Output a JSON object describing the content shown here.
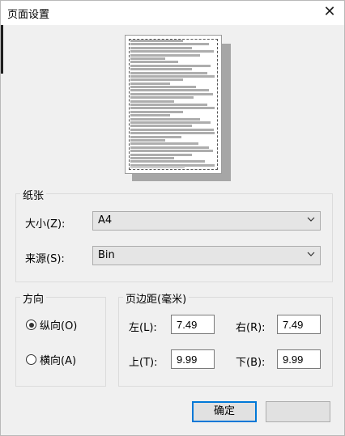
{
  "window": {
    "title": "页面设置",
    "close_glyph": "✕"
  },
  "paper": {
    "group_label": "纸张",
    "size_label": "大小(Z):",
    "size_value": "A4",
    "source_label": "来源(S):",
    "source_value": "Bin"
  },
  "orientation": {
    "group_label": "方向",
    "portrait_label": "纵向(O)",
    "landscape_label": "横向(A)",
    "selected": "portrait"
  },
  "margins": {
    "group_label": "页边距(毫米)",
    "left_label": "左(L):",
    "left_value": "7.49",
    "right_label": "右(R):",
    "right_value": "7.49",
    "top_label": "上(T):",
    "top_value": "9.99",
    "bottom_label": "下(B):",
    "bottom_value": "9.99"
  },
  "buttons": {
    "ok_label": "确定",
    "cancel_label": ""
  },
  "colors": {
    "accent": "#0078d7",
    "dialog_bg": "#f0f0f0"
  }
}
